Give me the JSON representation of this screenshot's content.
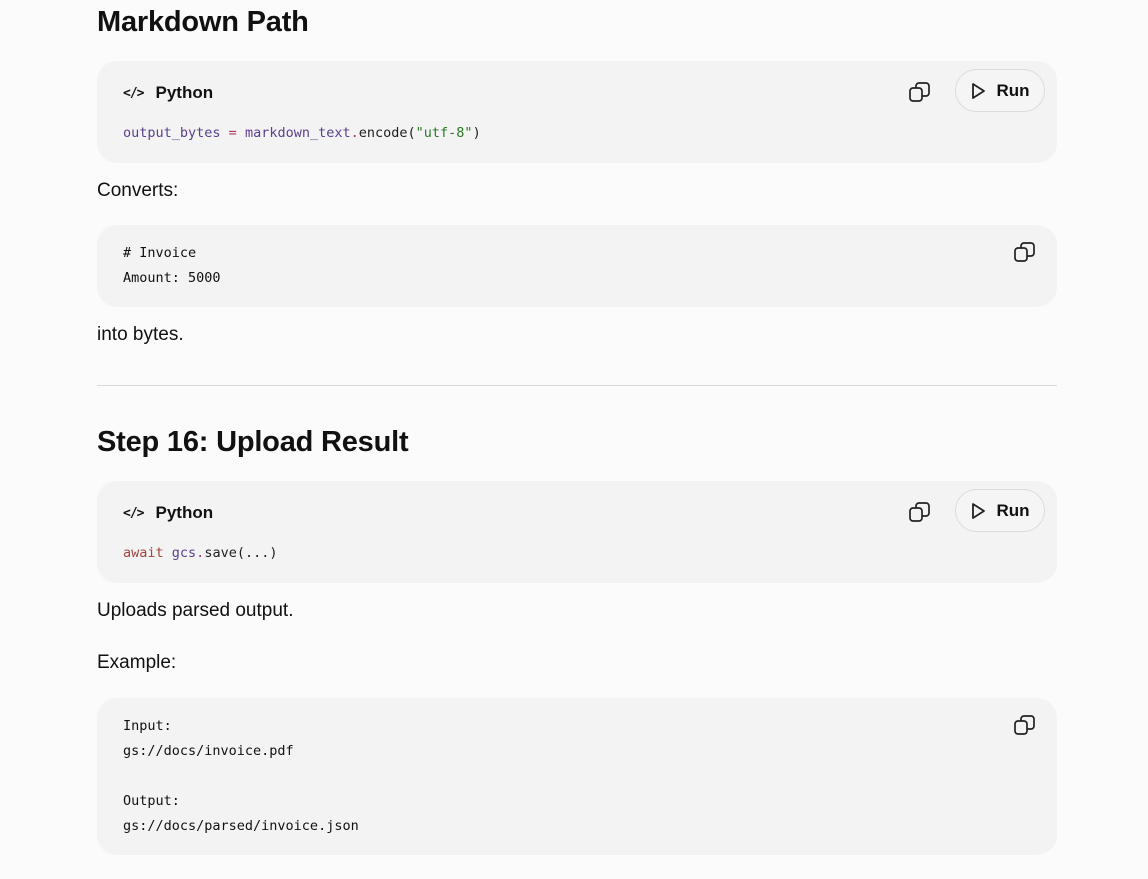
{
  "sections": [
    {
      "heading": "Markdown Path",
      "code1": {
        "language": "Python",
        "run_label": "Run",
        "tokens": {
          "a": "output_bytes",
          "b": " = ",
          "c": "markdown_text",
          "d": ".",
          "e": "encode(",
          "f": "\"utf-8\"",
          "g": ")"
        }
      },
      "text1": "Converts:",
      "code2": {
        "lines": [
          "# Invoice",
          "Amount: 5000"
        ]
      },
      "text2": "into bytes."
    },
    {
      "heading": "Step 16: Upload Result",
      "code1": {
        "language": "Python",
        "run_label": "Run",
        "tokens": {
          "a": "await",
          "b": " ",
          "c": "gcs",
          "d": ".",
          "e": "save(...)"
        }
      },
      "text1": "Uploads parsed output.",
      "text2": "Example:",
      "code2": {
        "lines": [
          "Input:",
          "gs://docs/invoice.pdf",
          "",
          "Output:",
          "gs://docs/parsed/invoice.json"
        ]
      }
    }
  ],
  "icons": {
    "code": "code-icon",
    "copy": "copy-icon",
    "play": "play-icon"
  }
}
